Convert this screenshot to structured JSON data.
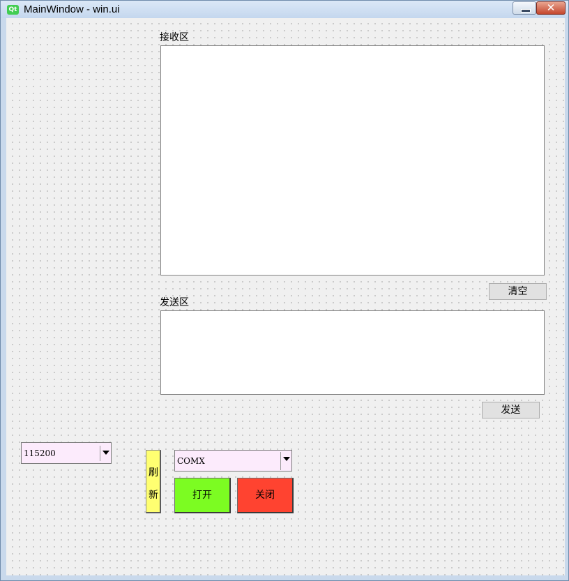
{
  "window": {
    "title": "MainWindow - win.ui",
    "app_icon_text": "Qt",
    "close_glyph": "✕"
  },
  "receive": {
    "label": "接收区",
    "content": "",
    "clear_button": "清空"
  },
  "send": {
    "label": "发送区",
    "content": "",
    "send_button": "发送"
  },
  "serial": {
    "baud_rate": "115200",
    "refresh_label_top": "刷",
    "refresh_label_bottom": "新",
    "port": "COMX",
    "open_button": "打开",
    "close_button": "关闭"
  },
  "colors": {
    "refresh_bg": "#ffff71",
    "open_bg": "#7cfc22",
    "close_bg": "#ff4330",
    "combo_bg": "#fcebfc"
  }
}
